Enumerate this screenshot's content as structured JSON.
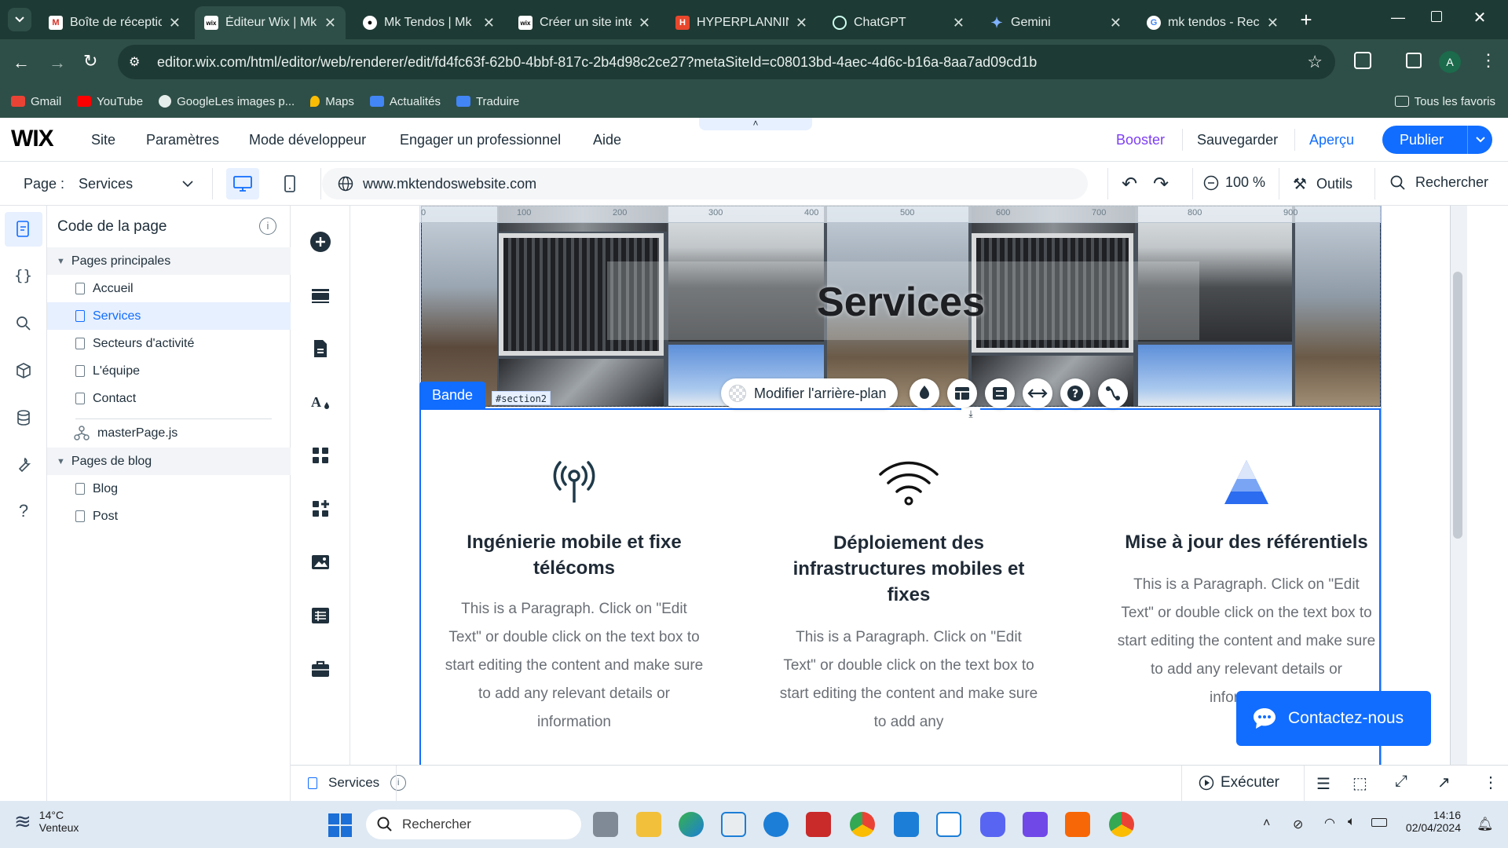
{
  "browser": {
    "tabs": [
      {
        "title": "Boîte de réception",
        "favicon": "gmail-icon",
        "active": false
      },
      {
        "title": "Éditeur Wix | Mk",
        "favicon": "wix-icon",
        "active": true
      },
      {
        "title": "Mk Tendos | Mk",
        "favicon": "site-icon",
        "active": false
      },
      {
        "title": "Créer un site inte",
        "favicon": "wix-icon",
        "active": false
      },
      {
        "title": "HYPERPLANNING",
        "favicon": "hyperplanning-icon",
        "active": false
      },
      {
        "title": "ChatGPT",
        "favicon": "chatgpt-icon",
        "active": false
      },
      {
        "title": "Gemini",
        "favicon": "gemini-icon",
        "active": false
      },
      {
        "title": "mk tendos - Rech",
        "favicon": "google-icon",
        "active": false
      }
    ],
    "url": "editor.wix.com/html/editor/web/renderer/edit/fd4fc63f-62b0-4bbf-817c-2b4d98c2ce27?metaSiteId=c08013bd-4aec-4d6c-b16a-8aa7ad09cd1b",
    "profile_initial": "A",
    "bookmarks": [
      "Gmail",
      "YouTube",
      "GoogleLes images p...",
      "Maps",
      "Actualités",
      "Traduire"
    ],
    "all_bookmarks": "Tous les favoris"
  },
  "wix": {
    "logo": "WIX",
    "menu": [
      "Site",
      "Paramètres",
      "Mode développeur",
      "Engager un professionnel",
      "Aide"
    ],
    "booster": "Booster",
    "save": "Sauvegarder",
    "preview": "Aperçu",
    "publish": "Publier",
    "page_label": "Page :",
    "page_name": "Services",
    "site_url": "www.mktendoswebsite.com",
    "zoom": "100 %",
    "tools": "Outils",
    "search": "Rechercher"
  },
  "code_panel": {
    "title": "Code de la page",
    "main_pages_header": "Pages principales",
    "main_pages": [
      "Accueil",
      "Services",
      "Secteurs d'activité",
      "L'équipe",
      "Contact"
    ],
    "selected_page": "Services",
    "master_page": "masterPage.js",
    "blog_header": "Pages de blog",
    "blog_pages": [
      "Blog",
      "Post"
    ]
  },
  "canvas": {
    "hero_title": "Services",
    "section_label": "Bande",
    "section_id": "#section2",
    "change_background": "Modifier l'arrière-plan",
    "ruler_ticks": [
      "0",
      "100",
      "200",
      "300",
      "400",
      "500",
      "600",
      "700",
      "800",
      "900"
    ],
    "cards": [
      {
        "title": "Ingénierie mobile et fixe télécoms",
        "icon": "antenna-icon",
        "text": "This is a Paragraph. Click on \"Edit Text\" or double click on the text box to start editing the content and make sure to add any relevant details or information"
      },
      {
        "title": "Déploiement des infrastructures mobiles et fixes",
        "icon": "wifi-icon",
        "text": "This is a Paragraph. Click on \"Edit Text\" or double click on the text box to start editing the content and make sure to add any"
      },
      {
        "title": "Mise à jour des référentiels",
        "icon": "pyramid-icon",
        "text": "This is a Paragraph. Click on \"Edit Text\" or double click on the text box to start editing the content and make sure to add any relevant details or information"
      }
    ],
    "contact_button": "Contactez-nous"
  },
  "bottom_bar": {
    "page": "Services",
    "run": "Exécuter"
  },
  "taskbar": {
    "weather_temp": "14°C",
    "weather_desc": "Venteux",
    "search_placeholder": "Rechercher",
    "time": "14:16",
    "date": "02/04/2024"
  },
  "colors": {
    "chrome_dark": "#1e3a34",
    "chrome_mid": "#2e4f47",
    "wix_blue": "#116dff",
    "booster_purple": "#7e3ff2",
    "selection_blue": "#116dff"
  }
}
